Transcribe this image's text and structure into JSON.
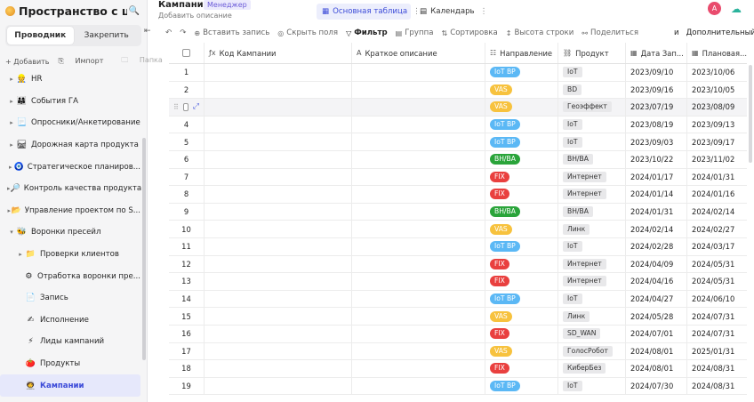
{
  "sidebar": {
    "title": "Пространство с ш...",
    "tabs": [
      "Проводник",
      "Закрепить"
    ],
    "actions": {
      "add": "+ Добавить",
      "import": "Импорт",
      "folder": "Папка"
    },
    "items": [
      {
        "label": "HR",
        "icon": "👷",
        "arrow": "▸",
        "indent": 0
      },
      {
        "label": "События ГА",
        "icon": "👨‍👩‍👧",
        "arrow": "▸",
        "indent": 0
      },
      {
        "label": "Опросники/Анкетирование",
        "icon": "📃",
        "arrow": "▸",
        "indent": 0
      },
      {
        "label": "Дорожная карта продукта",
        "icon": "🛤",
        "arrow": "▸",
        "indent": 0
      },
      {
        "label": "Стратегическое планиров...",
        "icon": "🧿",
        "arrow": "▸",
        "indent": 0
      },
      {
        "label": "Контроль качества продукта",
        "icon": "🔎",
        "arrow": "▸",
        "indent": 0
      },
      {
        "label": "Управление проектом по S...",
        "icon": "📂",
        "arrow": "▸",
        "indent": 0
      },
      {
        "label": "Воронки пресейл",
        "icon": "🐝",
        "arrow": "▾",
        "indent": 0
      },
      {
        "label": "Проверки клиентов",
        "icon": "📁",
        "arrow": "▸",
        "indent": 1
      },
      {
        "label": "Отработка воронки пре...",
        "icon": "⚙",
        "arrow": "",
        "indent": 1
      },
      {
        "label": "Запись",
        "icon": "📄",
        "arrow": "",
        "indent": 1
      },
      {
        "label": "Исполнение",
        "icon": "✍",
        "arrow": "",
        "indent": 1
      },
      {
        "label": "Лиды кампаний",
        "icon": "⚡",
        "arrow": "",
        "indent": 1
      },
      {
        "label": "Продукты",
        "icon": "🍅",
        "arrow": "",
        "indent": 1
      },
      {
        "label": "Кампании",
        "icon": "🧑‍🚀",
        "arrow": "",
        "indent": 1,
        "active": true
      }
    ]
  },
  "header": {
    "title": "Кампании",
    "role_badge": "Менеджер",
    "description": "Добавить описание",
    "views": [
      {
        "label": "Основная таблица",
        "icon": "▦"
      },
      {
        "label": "Календарь",
        "icon": "▤"
      }
    ],
    "avatar_letter": "A"
  },
  "toolbar": {
    "undo": "↶",
    "redo": "↷",
    "insert": "Вставить запись",
    "hide": "Скрыть поля",
    "filter": "Фильтр",
    "group": "Группа",
    "sort": "Сортировка",
    "row_height": "Высота строки",
    "share": "Поделиться",
    "more_prefix": "и",
    "more": "Дополнительный"
  },
  "columns": [
    {
      "label": "Код Кампании",
      "icon": "ƒx"
    },
    {
      "label": "Краткое описание",
      "icon": "A"
    },
    {
      "label": "Направление",
      "icon": "☷"
    },
    {
      "label": "Продукт",
      "icon": "⛓"
    },
    {
      "label": "Дата Зап...",
      "icon": "▦"
    },
    {
      "label": "Плановая...",
      "icon": "▦"
    }
  ],
  "colors": {
    "IoT BP": "#5bb8f5",
    "VAS": "#f7c23e",
    "BH/BA": "#2aa43a",
    "FIX": "#e9403f"
  },
  "rows": [
    {
      "n": "1",
      "dir": "IoT BP",
      "prod": "IoT",
      "d1": "2023/09/10",
      "d2": "2023/10/06"
    },
    {
      "n": "2",
      "dir": "VAS",
      "prod": "BD",
      "d1": "2023/09/16",
      "d2": "2023/10/05"
    },
    {
      "n": "",
      "dir": "VAS",
      "prod": "Геоэффект",
      "d1": "2023/07/19",
      "d2": "2023/08/09",
      "hover": true
    },
    {
      "n": "4",
      "dir": "IoT BP",
      "prod": "IoT",
      "d1": "2023/08/19",
      "d2": "2023/09/13"
    },
    {
      "n": "5",
      "dir": "IoT BP",
      "prod": "IoT",
      "d1": "2023/09/03",
      "d2": "2023/09/17"
    },
    {
      "n": "6",
      "dir": "BH/BA",
      "prod": "BH/BA",
      "d1": "2023/10/22",
      "d2": "2023/11/02"
    },
    {
      "n": "7",
      "dir": "FIX",
      "prod": "Интернет",
      "d1": "2024/01/17",
      "d2": "2024/01/31"
    },
    {
      "n": "8",
      "dir": "FIX",
      "prod": "Интернет",
      "d1": "2024/01/14",
      "d2": "2024/01/16"
    },
    {
      "n": "9",
      "dir": "BH/BA",
      "prod": "BH/BA",
      "d1": "2024/01/31",
      "d2": "2024/02/14"
    },
    {
      "n": "10",
      "dir": "VAS",
      "prod": "Линк",
      "d1": "2024/02/14",
      "d2": "2024/02/27"
    },
    {
      "n": "11",
      "dir": "IoT BP",
      "prod": "IoT",
      "d1": "2024/02/28",
      "d2": "2024/03/17"
    },
    {
      "n": "12",
      "dir": "FIX",
      "prod": "Интернет",
      "d1": "2024/04/09",
      "d2": "2024/05/31"
    },
    {
      "n": "13",
      "dir": "FIX",
      "prod": "Интернет",
      "d1": "2024/04/16",
      "d2": "2024/05/31"
    },
    {
      "n": "14",
      "dir": "IoT BP",
      "prod": "IoT",
      "d1": "2024/04/27",
      "d2": "2024/06/10"
    },
    {
      "n": "15",
      "dir": "VAS",
      "prod": "Линк",
      "d1": "2024/05/28",
      "d2": "2024/07/31"
    },
    {
      "n": "16",
      "dir": "FIX",
      "prod": "SD_WAN",
      "d1": "2024/07/01",
      "d2": "2024/07/31"
    },
    {
      "n": "17",
      "dir": "VAS",
      "prod": "ГолосРобот",
      "d1": "2024/08/01",
      "d2": "2025/01/31"
    },
    {
      "n": "18",
      "dir": "FIX",
      "prod": "КиберБез",
      "d1": "2024/08/01",
      "d2": "2024/08/31"
    },
    {
      "n": "19",
      "dir": "IoT BP",
      "prod": "IoT",
      "d1": "2024/07/30",
      "d2": "2024/08/31"
    }
  ]
}
